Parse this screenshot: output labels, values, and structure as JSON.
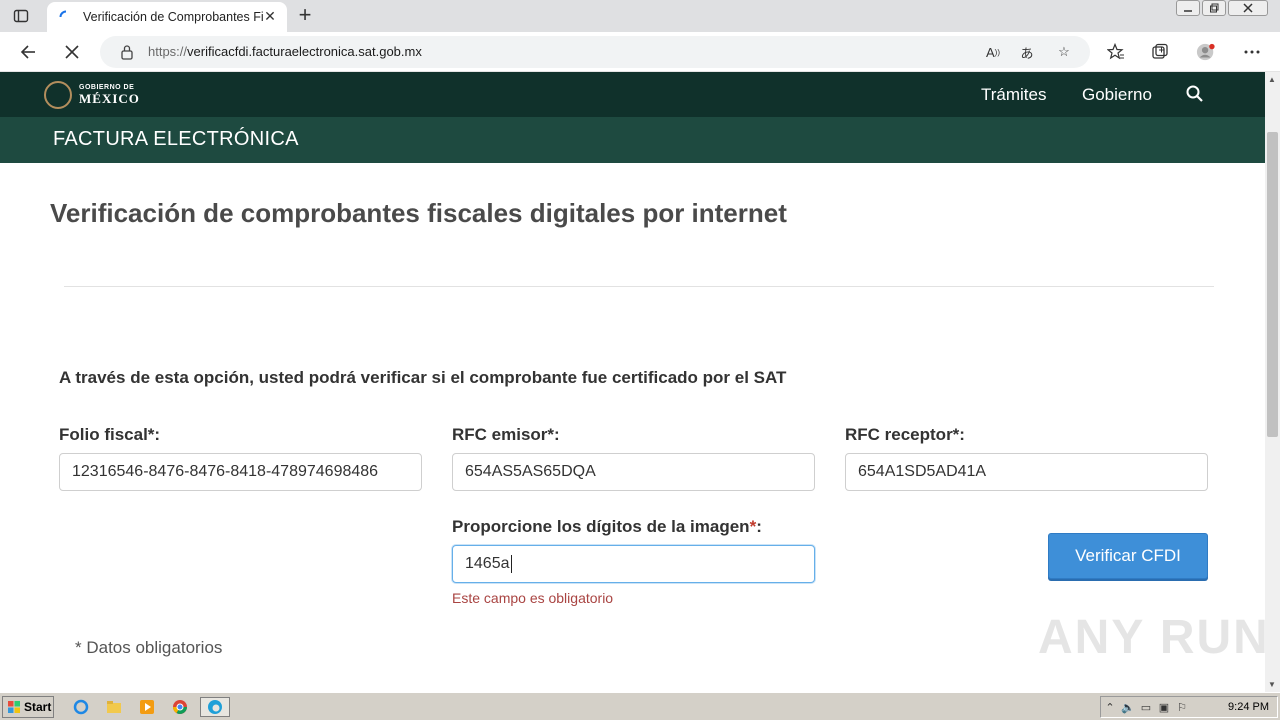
{
  "browser": {
    "tab_title": "Verificación de Comprobantes Fi",
    "url_scheme": "https://",
    "url_host": "verificacfdi.facturaelectronica.sat.gob.mx"
  },
  "site": {
    "logo_line1": "GOBIERNO DE",
    "logo_line2": "MÉXICO",
    "nav_items": [
      "Trámites",
      "Gobierno"
    ],
    "section_name": "FACTURA ELECTRÓNICA"
  },
  "page": {
    "title": "Verificación de comprobantes fiscales digitales por internet",
    "description": "A través de esta opción, usted podrá verificar si el comprobante fue certificado por el SAT",
    "folio_label": "Folio fiscal*:",
    "folio_value": "12316546-8476-8476-8418-478974698486",
    "rfc_emisor_label": "RFC emisor*:",
    "rfc_emisor_value": "654AS5AS65DQA",
    "rfc_receptor_label": "RFC receptor*:",
    "rfc_receptor_value": "654A1SD5AD41A",
    "captcha_label": "Proporcione los dígitos de la imagen",
    "captcha_req": "*",
    "captcha_colon": ":",
    "captcha_value": "1465a",
    "error_text": "Este campo es obligatorio",
    "submit_label": "Verificar CFDI",
    "required_note": "* Datos obligatorios"
  },
  "watermark": "ANY RUN",
  "taskbar": {
    "start_label": "Start",
    "clock": "9:24 PM"
  },
  "colors": {
    "header_dark": "#10312b",
    "header_sub": "#1e4a40",
    "button_blue": "#3e8fd8",
    "error_red": "#a94442"
  }
}
